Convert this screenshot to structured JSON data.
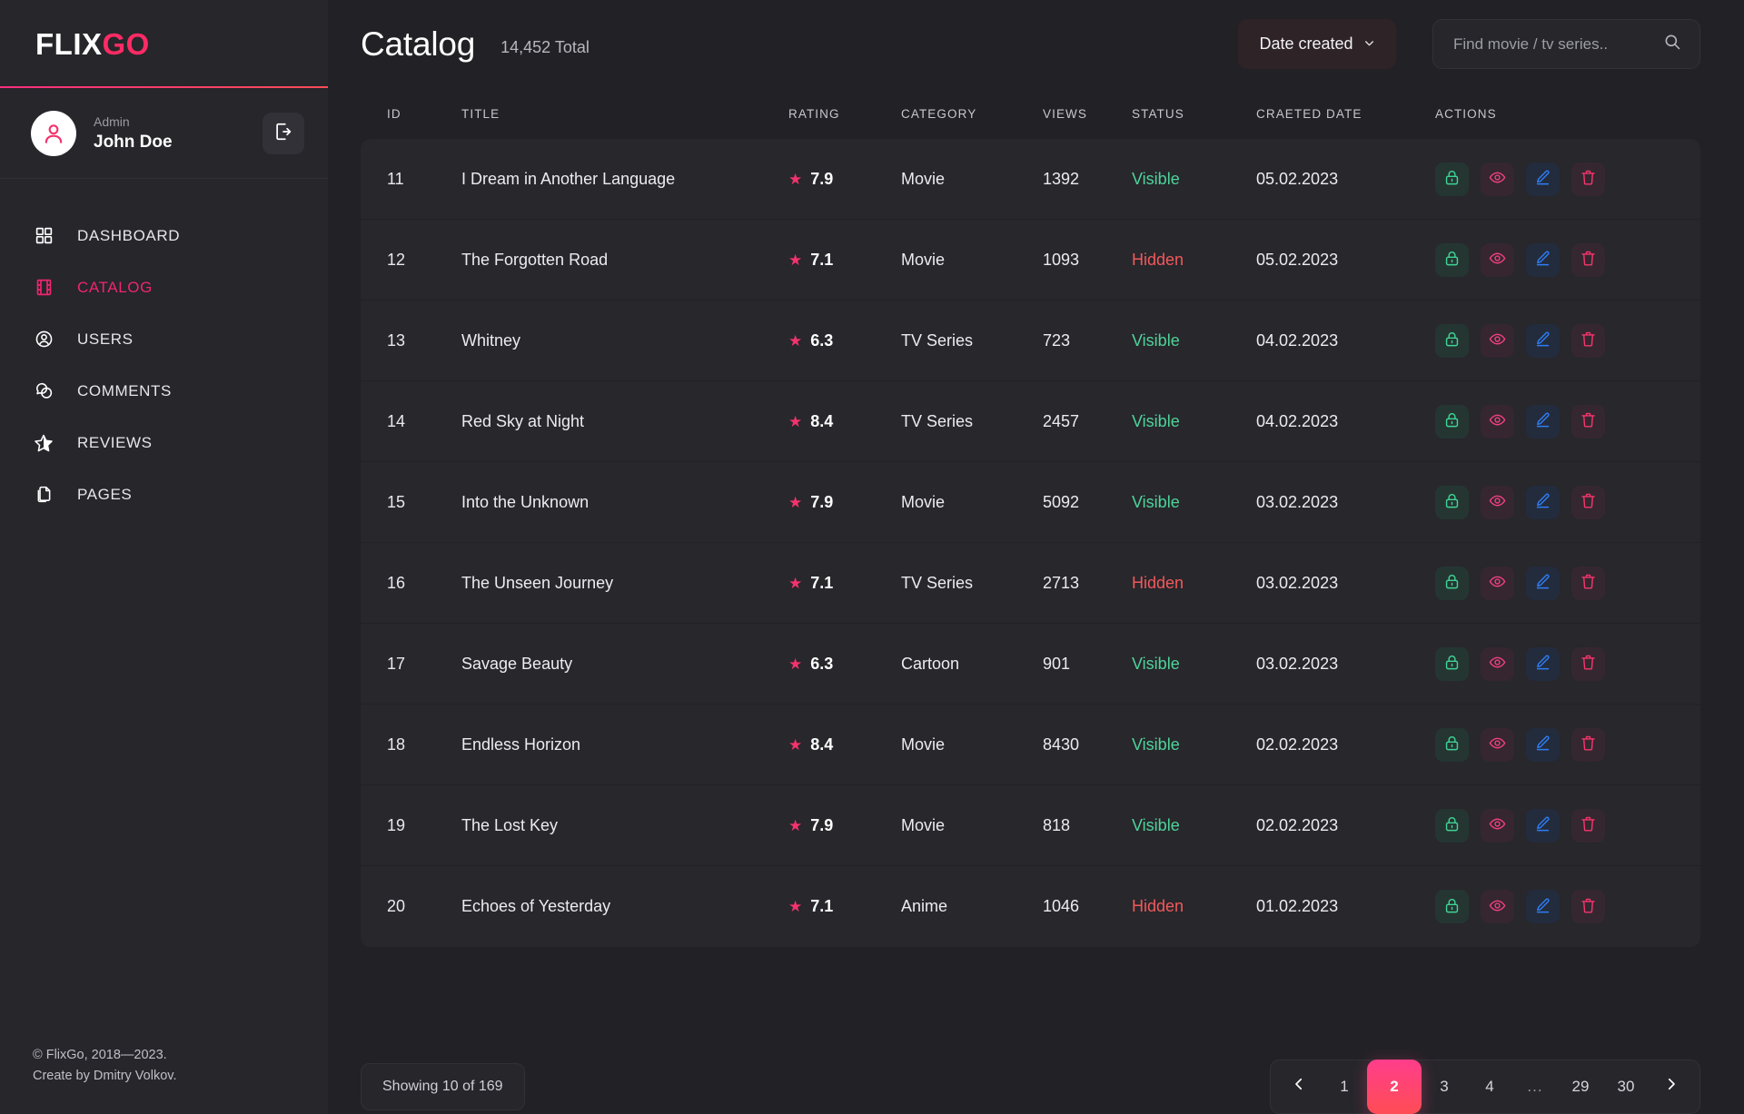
{
  "brand": {
    "name_light": "FLIX",
    "name_accent": "GO",
    "accent_color": "#f0256e"
  },
  "user": {
    "role": "Admin",
    "name": "John Doe",
    "logout_icon": "logout-icon"
  },
  "sidebar": {
    "items": [
      {
        "label": "DASHBOARD",
        "icon": "grid-icon",
        "active": false
      },
      {
        "label": "CATALOG",
        "icon": "film-icon",
        "active": true
      },
      {
        "label": "USERS",
        "icon": "user-circle-icon",
        "active": false
      },
      {
        "label": "COMMENTS",
        "icon": "comments-icon",
        "active": false
      },
      {
        "label": "REVIEWS",
        "icon": "star-half-icon",
        "active": false
      },
      {
        "label": "PAGES",
        "icon": "pages-icon",
        "active": false
      }
    ],
    "footer_line1": "© FlixGo, 2018—2023.",
    "footer_line2": "Create by Dmitry Volkov."
  },
  "header": {
    "title": "Catalog",
    "total": "14,452 Total",
    "sort_label": "Date created",
    "sort_icon": "chevron-down-icon",
    "search_placeholder": "Find movie / tv series..",
    "search_value": "",
    "search_icon": "search-icon"
  },
  "table": {
    "columns": [
      "ID",
      "TITLE",
      "RATING",
      "CATEGORY",
      "VIEWS",
      "STATUS",
      "CRAETED DATE",
      "ACTIONS"
    ],
    "action_icons": [
      "lock-icon",
      "eye-icon",
      "pencil-icon",
      "trash-icon"
    ],
    "rows": [
      {
        "id": "11",
        "title": "I Dream in Another Language",
        "rating": "7.9",
        "category": "Movie",
        "views": "1392",
        "status": "Visible",
        "date": "05.02.2023"
      },
      {
        "id": "12",
        "title": "The Forgotten Road",
        "rating": "7.1",
        "category": "Movie",
        "views": "1093",
        "status": "Hidden",
        "date": "05.02.2023"
      },
      {
        "id": "13",
        "title": "Whitney",
        "rating": "6.3",
        "category": "TV Series",
        "views": "723",
        "status": "Visible",
        "date": "04.02.2023"
      },
      {
        "id": "14",
        "title": "Red Sky at Night",
        "rating": "8.4",
        "category": "TV Series",
        "views": "2457",
        "status": "Visible",
        "date": "04.02.2023"
      },
      {
        "id": "15",
        "title": "Into the Unknown",
        "rating": "7.9",
        "category": "Movie",
        "views": "5092",
        "status": "Visible",
        "date": "03.02.2023"
      },
      {
        "id": "16",
        "title": "The Unseen Journey",
        "rating": "7.1",
        "category": "TV Series",
        "views": "2713",
        "status": "Hidden",
        "date": "03.02.2023"
      },
      {
        "id": "17",
        "title": "Savage Beauty",
        "rating": "6.3",
        "category": "Cartoon",
        "views": "901",
        "status": "Visible",
        "date": "03.02.2023"
      },
      {
        "id": "18",
        "title": "Endless Horizon",
        "rating": "8.4",
        "category": "Movie",
        "views": "8430",
        "status": "Visible",
        "date": "02.02.2023"
      },
      {
        "id": "19",
        "title": "The Lost Key",
        "rating": "7.9",
        "category": "Movie",
        "views": "818",
        "status": "Visible",
        "date": "02.02.2023"
      },
      {
        "id": "20",
        "title": "Echoes of Yesterday",
        "rating": "7.1",
        "category": "Anime",
        "views": "1046",
        "status": "Hidden",
        "date": "01.02.2023"
      }
    ]
  },
  "footer": {
    "showing": "Showing 10 of 169",
    "pagination": {
      "prev_icon": "chevron-left-icon",
      "next_icon": "chevron-right-icon",
      "pages": [
        "1",
        "2",
        "3",
        "4",
        "...",
        "29",
        "30"
      ],
      "active": "2"
    }
  },
  "colors": {
    "accent_pink": "#f0256e",
    "status_visible": "#4fd39a",
    "status_hidden": "#f2595b",
    "sidebar_bg": "#26262b",
    "main_bg": "#222226",
    "row_bg": "#27272c"
  }
}
